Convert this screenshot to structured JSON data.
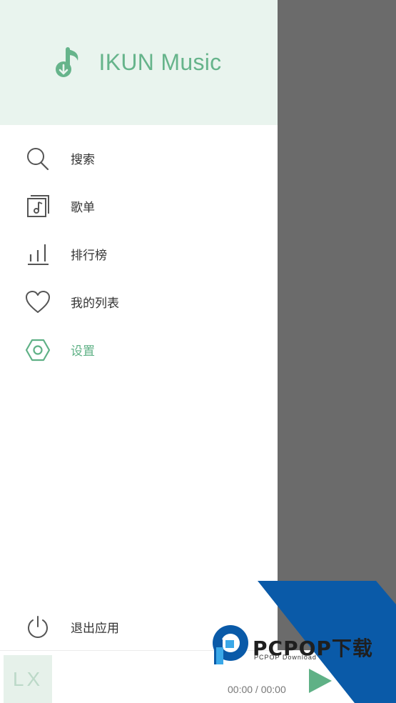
{
  "app": {
    "title": "IKUN Music"
  },
  "menu": {
    "items": [
      {
        "label": "搜索",
        "icon": "search-icon"
      },
      {
        "label": "歌单",
        "icon": "songlist-icon"
      },
      {
        "label": "排行榜",
        "icon": "chart-bars-icon"
      },
      {
        "label": "我的列表",
        "icon": "heart-icon"
      },
      {
        "label": "设置",
        "icon": "settings-icon",
        "active": true
      }
    ],
    "exit_label": "退出应用"
  },
  "player": {
    "cover_text": "LX",
    "time": "00:00 / 00:00"
  },
  "watermark": {
    "brand": "PCPOP下载",
    "sub": "PCPOP Download"
  },
  "colors": {
    "accent": "#5fb186",
    "header_bg": "#e9f4ee",
    "overlay": "#6b6b6b",
    "watermark_blue": "#0a5aa8"
  }
}
